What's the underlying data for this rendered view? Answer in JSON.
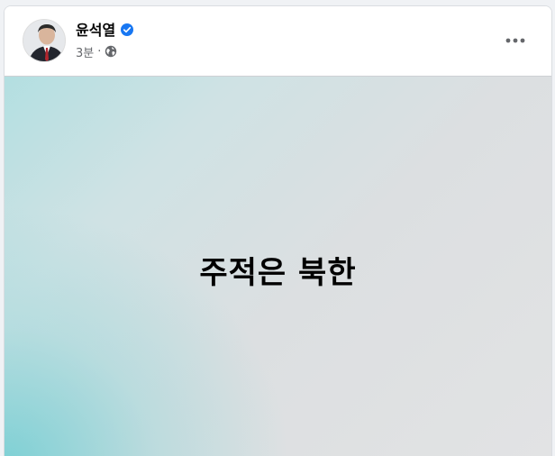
{
  "post": {
    "author": {
      "name": "윤석열",
      "verified": true,
      "avatar_icon": "profile-photo"
    },
    "timestamp": "3분",
    "separator": "·",
    "privacy_icon": "globe-icon",
    "more_options_icon": "more-horizontal-icon",
    "body_text": "주적은 북한"
  },
  "colors": {
    "verified_blue": "#1877f2",
    "meta_gray": "#65676b",
    "gradient_teal": "#6ecdd2",
    "gradient_gray": "#e2e3e4"
  }
}
